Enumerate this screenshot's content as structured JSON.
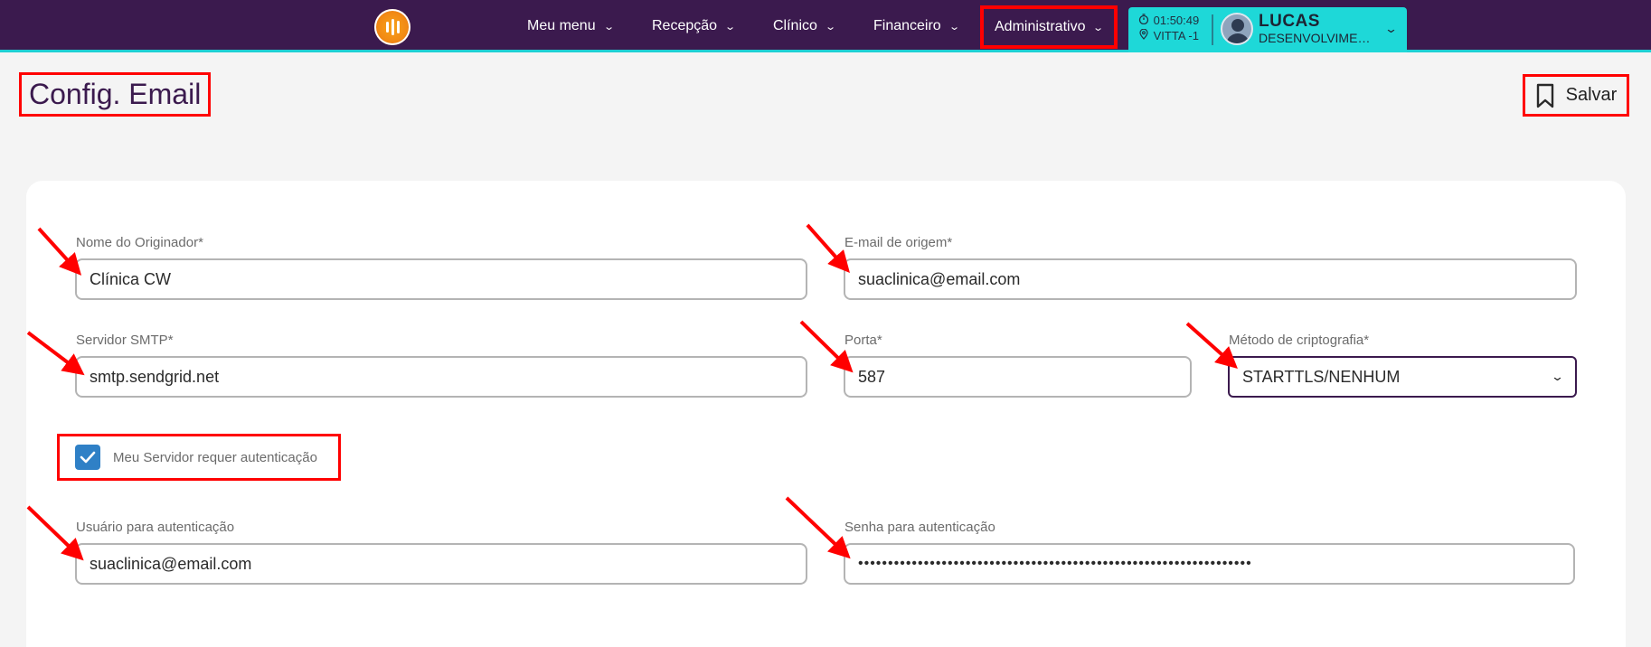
{
  "nav": {
    "items": [
      {
        "label": "Meu menu"
      },
      {
        "label": "Recepção"
      },
      {
        "label": "Clínico"
      },
      {
        "label": "Financeiro"
      },
      {
        "label": "Administrativo"
      }
    ],
    "chevron": "⌄"
  },
  "status": {
    "time": "01:50:49",
    "location": "VITTA -1",
    "user_name": "LUCAS",
    "user_role": "DESENVOLVIMENTO"
  },
  "page": {
    "title": "Config. Email",
    "save_label": "Salvar"
  },
  "form": {
    "originator_label": "Nome do Originador*",
    "originator_value": "Clínica CW",
    "origin_email_label": "E-mail de origem*",
    "origin_email_value": "suaclinica@email.com",
    "smtp_label": "Servidor SMTP*",
    "smtp_value": "smtp.sendgrid.net",
    "port_label": "Porta*",
    "port_value": "587",
    "crypto_label": "Método de criptografia*",
    "crypto_value": "STARTTLS/NENHUM",
    "auth_checkbox_label": "Meu Servidor requer autenticação",
    "auth_checked": true,
    "auth_user_label": "Usuário para autenticação",
    "auth_user_value": "suaclinica@email.com",
    "auth_pass_label": "Senha para autenticação",
    "auth_pass_value": "••••••••••••••••••••••••••••••••••••••••••••••••••••••••••••••••••"
  },
  "colors": {
    "topbar": "#3b1a4e",
    "accent": "#1ecfd3",
    "highlight": "#ff0000",
    "checkbox": "#2f80c6"
  }
}
